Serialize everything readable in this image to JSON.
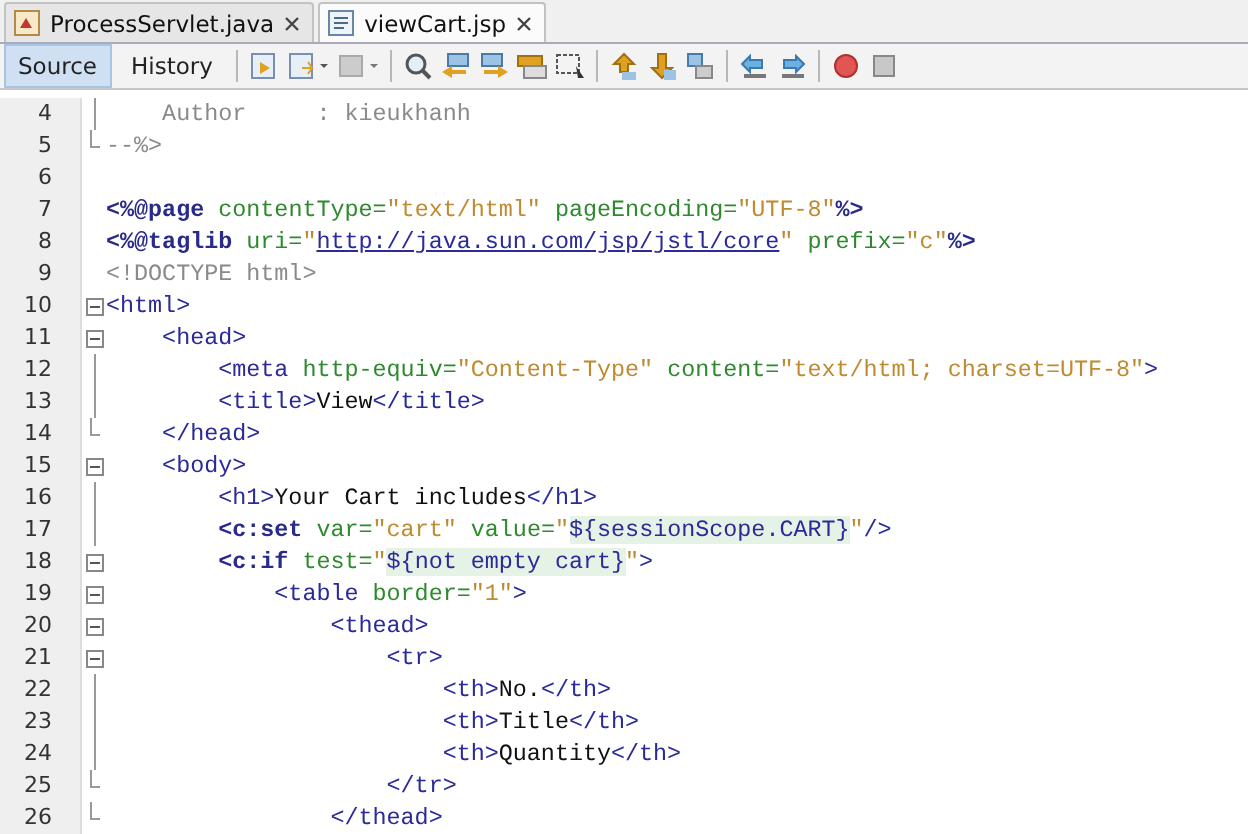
{
  "tabs": [
    {
      "label": "ProcessServlet.java",
      "selected": false,
      "kind": "java"
    },
    {
      "label": "viewCart.jsp",
      "selected": true,
      "kind": "jsp"
    }
  ],
  "view_toggle": [
    {
      "label": "Source",
      "selected": true
    },
    {
      "label": "History",
      "selected": false
    }
  ],
  "editor": {
    "lines": [
      {
        "number": "4",
        "fold_start": false,
        "fold_end": false,
        "tokens": [
          {
            "kind": "comment",
            "text": "    Author     : kieukhanh"
          }
        ]
      },
      {
        "number": "5",
        "fold_start": false,
        "fold_end": true,
        "tokens": [
          {
            "kind": "comment",
            "text": "--%>"
          }
        ]
      },
      {
        "number": "6",
        "fold_start": false,
        "fold_end": false
      },
      {
        "number": "7",
        "fold_start": false,
        "fold_end": false,
        "tokens": [
          {
            "kind": "directive",
            "text": "<%@page"
          },
          {
            "kind": "attr",
            "text": " contentType="
          },
          {
            "kind": "string",
            "text": "\"text/html\""
          },
          {
            "kind": "attr",
            "text": " pageEncoding="
          },
          {
            "kind": "string",
            "text": "\"UTF-8\""
          },
          {
            "kind": "directive",
            "text": "%>"
          }
        ]
      },
      {
        "number": "8",
        "fold_start": false,
        "fold_end": false,
        "tokens": [
          {
            "kind": "directive",
            "text": "<%@taglib"
          },
          {
            "kind": "attr",
            "text": " uri="
          },
          {
            "kind": "string",
            "text": "\""
          },
          {
            "kind": "link",
            "text": "http://java.sun.com/jsp/jstl/core"
          },
          {
            "kind": "string",
            "text": "\""
          },
          {
            "kind": "attr",
            "text": " prefix="
          },
          {
            "kind": "string",
            "text": "\"c\""
          },
          {
            "kind": "directive",
            "text": "%>"
          }
        ]
      },
      {
        "number": "9",
        "fold_start": false,
        "fold_end": false,
        "tokens": [
          {
            "kind": "comment",
            "text": "<!DOCTYPE html>"
          }
        ]
      },
      {
        "number": "10",
        "fold_start": true,
        "fold_end": false,
        "tokens": [
          {
            "kind": "tag",
            "text": "<html>"
          }
        ]
      },
      {
        "number": "11",
        "fold_start": true,
        "fold_end": false,
        "tokens": [
          {
            "kind": "tag",
            "text": "    <head>"
          }
        ]
      },
      {
        "number": "12",
        "fold_start": false,
        "fold_end": false,
        "tokens": [
          {
            "kind": "tag",
            "text": "        <meta"
          },
          {
            "kind": "attr",
            "text": " http-equiv="
          },
          {
            "kind": "string",
            "text": "\"Content-Type\""
          },
          {
            "kind": "attr",
            "text": " content="
          },
          {
            "kind": "string",
            "text": "\"text/html; charset=UTF-8\""
          },
          {
            "kind": "tag",
            "text": ">"
          }
        ]
      },
      {
        "number": "13",
        "fold_start": false,
        "fold_end": false,
        "tokens": [
          {
            "kind": "tag",
            "text": "        <title>"
          },
          {
            "kind": "plain",
            "text": "View"
          },
          {
            "kind": "tag",
            "text": "</title>"
          }
        ]
      },
      {
        "number": "14",
        "fold_start": false,
        "fold_end": true,
        "tokens": [
          {
            "kind": "tag",
            "text": "    </head>"
          }
        ]
      },
      {
        "number": "15",
        "fold_start": true,
        "fold_end": false,
        "tokens": [
          {
            "kind": "tag",
            "text": "    <body>"
          }
        ]
      },
      {
        "number": "16",
        "fold_start": false,
        "fold_end": false,
        "tokens": [
          {
            "kind": "tag",
            "text": "        <h1>"
          },
          {
            "kind": "plain",
            "text": "Your Cart includes"
          },
          {
            "kind": "tag",
            "text": "</h1>"
          }
        ]
      },
      {
        "number": "17",
        "fold_start": false,
        "fold_end": false,
        "tokens": [
          {
            "kind": "jstl",
            "text": "        <c:set"
          },
          {
            "kind": "attr",
            "text": " var="
          },
          {
            "kind": "string",
            "text": "\"cart\""
          },
          {
            "kind": "attr",
            "text": " value="
          },
          {
            "kind": "string",
            "text": "\""
          },
          {
            "kind": "el",
            "text": "${sessionScope.CART}"
          },
          {
            "kind": "string",
            "text": "\""
          },
          {
            "kind": "tag",
            "text": "/>"
          }
        ]
      },
      {
        "number": "18",
        "fold_start": true,
        "fold_end": false,
        "tokens": [
          {
            "kind": "jstl",
            "text": "        <c:if"
          },
          {
            "kind": "attr",
            "text": " test="
          },
          {
            "kind": "string",
            "text": "\""
          },
          {
            "kind": "el",
            "text": "${not empty cart}"
          },
          {
            "kind": "string",
            "text": "\""
          },
          {
            "kind": "tag",
            "text": ">"
          }
        ]
      },
      {
        "number": "19",
        "fold_start": true,
        "fold_end": false,
        "tokens": [
          {
            "kind": "tag",
            "text": "            <table"
          },
          {
            "kind": "attr",
            "text": " border="
          },
          {
            "kind": "string",
            "text": "\"1\""
          },
          {
            "kind": "tag",
            "text": ">"
          }
        ]
      },
      {
        "number": "20",
        "fold_start": true,
        "fold_end": false,
        "tokens": [
          {
            "kind": "tag",
            "text": "                <thead>"
          }
        ]
      },
      {
        "number": "21",
        "fold_start": true,
        "fold_end": false,
        "tokens": [
          {
            "kind": "tag",
            "text": "                    <tr>"
          }
        ]
      },
      {
        "number": "22",
        "fold_start": false,
        "fold_end": false,
        "tokens": [
          {
            "kind": "tag",
            "text": "                        <th>"
          },
          {
            "kind": "plain",
            "text": "No."
          },
          {
            "kind": "tag",
            "text": "</th>"
          }
        ]
      },
      {
        "number": "23",
        "fold_start": false,
        "fold_end": false,
        "tokens": [
          {
            "kind": "tag",
            "text": "                        <th>"
          },
          {
            "kind": "plain",
            "text": "Title"
          },
          {
            "kind": "tag",
            "text": "</th>"
          }
        ]
      },
      {
        "number": "24",
        "fold_start": false,
        "fold_end": false,
        "tokens": [
          {
            "kind": "tag",
            "text": "                        <th>"
          },
          {
            "kind": "plain",
            "text": "Quantity"
          },
          {
            "kind": "tag",
            "text": "</th>"
          }
        ]
      },
      {
        "number": "25",
        "fold_start": false,
        "fold_end": true,
        "tokens": [
          {
            "kind": "tag",
            "text": "                    </tr>"
          }
        ]
      },
      {
        "number": "26",
        "fold_start": false,
        "fold_end": true,
        "tokens": [
          {
            "kind": "tag",
            "text": "                </thead>"
          }
        ]
      }
    ]
  }
}
